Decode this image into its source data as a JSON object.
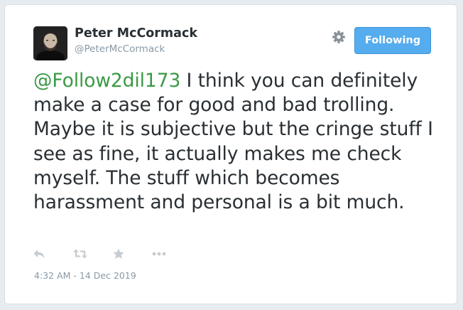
{
  "author": {
    "display_name": "Peter McCormack",
    "handle": "@PeterMcCormack",
    "avatar_icon": "profile-photo"
  },
  "header": {
    "settings_icon": "gear-icon",
    "follow_label": "Following"
  },
  "tweet": {
    "mention": "@Follow2dil173",
    "body": " I think you can definitely make a case for good and bad trolling. Maybe it is subjective but the cringe stuff I see as fine, it actually makes me check myself. The stuff which becomes harassment and personal is a bit much.",
    "timestamp": "4:32 AM - 14 Dec 2019"
  },
  "actions": {
    "reply_icon": "reply-icon",
    "retweet_icon": "retweet-icon",
    "favorite_icon": "star-icon",
    "more_icon": "more-icon"
  },
  "colors": {
    "mention": "#3a9a44",
    "follow_button": "#55acee",
    "text": "#292f33",
    "muted": "#8899a6"
  }
}
